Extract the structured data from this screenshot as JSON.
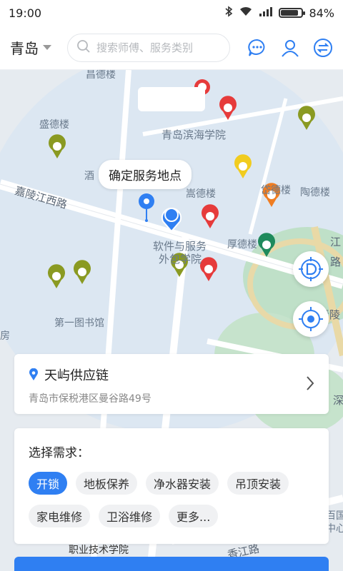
{
  "status": {
    "time": "19:00",
    "battery": "84%",
    "battery_level": 0.84
  },
  "header": {
    "city": "青岛",
    "search_placeholder": "搜索师傅、服务类别"
  },
  "map": {
    "labels": {
      "changdelou": "昌德楼",
      "shengdelou": "盛德楼",
      "binhai": "青岛滨海学院",
      "jiu": "酒",
      "song": "嵩德楼",
      "dai": "岱德楼",
      "tao": "陶德楼",
      "jialing": "嘉陵江西路",
      "software1": "软件与服务",
      "software2": "外包学院",
      "houde": "厚德楼",
      "library": "第一图书馆",
      "fang": "房",
      "jiang": "江",
      "lu": "路",
      "qingling": "青陵",
      "shen": "深",
      "baiguang1": "百国",
      "baiguang2": "中心",
      "zhiye": "职业技术学院",
      "xiangjiang": "香江路"
    },
    "tooltip": "确定服务地点"
  },
  "address": {
    "name": "天屿供应链",
    "detail": "青岛市保税港区曼谷路49号"
  },
  "needs": {
    "title": "选择需求：",
    "options": [
      "开锁",
      "地板保养",
      "净水器安装",
      "吊顶安装",
      "家电维修",
      "卫浴维修",
      "更多..."
    ],
    "selected": "开锁"
  },
  "colors": {
    "accent": "#2f7ff2"
  }
}
